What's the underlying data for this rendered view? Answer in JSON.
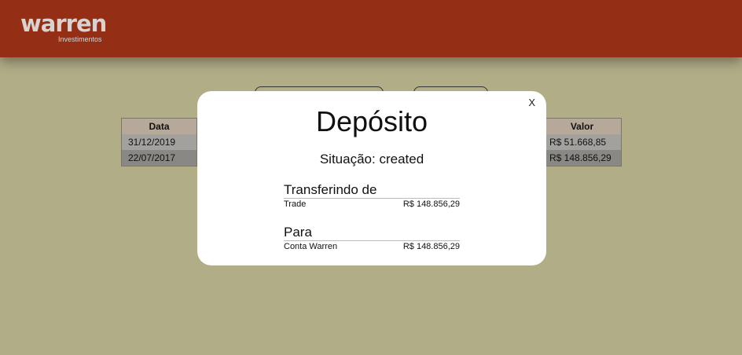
{
  "header": {
    "logo_word": "warren",
    "logo_sub": "Investimentos"
  },
  "background_table": {
    "left_header": "Data",
    "right_header": "Valor",
    "rows": [
      {
        "date": "31/12/2019",
        "value": "R$ 51.668,85"
      },
      {
        "date": "22/07/2017",
        "value": "R$ 148.856,29"
      }
    ]
  },
  "modal": {
    "close_label": "X",
    "title": "Depósito",
    "status_label": "Situação:",
    "status_value": "created",
    "from": {
      "heading": "Transferindo de",
      "name": "Trade",
      "amount": "R$ 148.856,29"
    },
    "to": {
      "heading": "Para",
      "name": "Conta Warren",
      "amount": "R$ 148.856,29"
    }
  },
  "colors": {
    "header": "#942e15",
    "background": "#b0ad87",
    "modal": "#ffffff"
  }
}
